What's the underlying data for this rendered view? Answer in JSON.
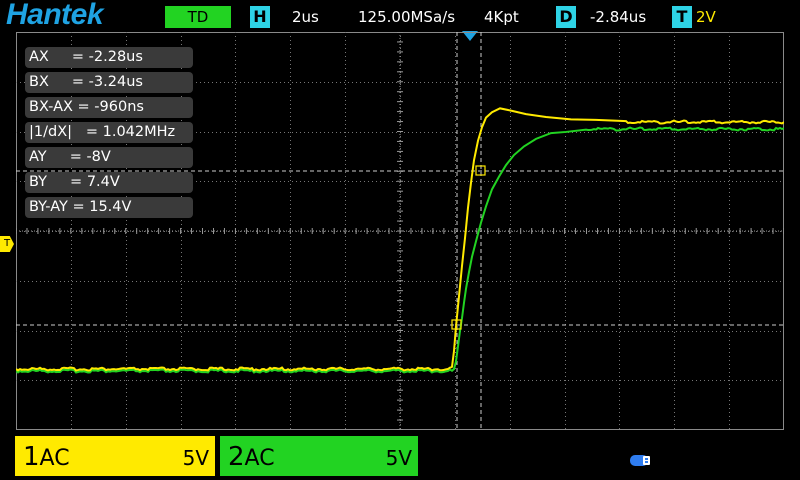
{
  "header": {
    "logo": "Hantek",
    "trigger_mode": "TD",
    "horizontal_label": "H",
    "timebase": "2us",
    "sample_rate": "125.00MSa/s",
    "memory_depth": "4Kpt",
    "delay_label": "D",
    "delay_value": "-2.84us",
    "trigger_label": "T",
    "trigger_level": "2V"
  },
  "measurements": [
    "AX     = -2.28us",
    "BX     = -3.24us",
    "BX-AX = -960ns",
    "|1/dX|   = 1.042MHz",
    "AY     = -8V",
    "BY     = 7.4V",
    "BY-AY = 15.4V"
  ],
  "trigger_level_marker": "T",
  "channels": [
    {
      "number": "1",
      "coupling": "AC",
      "scale": "5V",
      "color": "#ffea00"
    },
    {
      "number": "2",
      "coupling": "AC",
      "scale": "5V",
      "color": "#22d322"
    }
  ],
  "colors": {
    "accent": "#1fa3e3",
    "ch1": "#ffea00",
    "ch2": "#22d322",
    "cyan_label": "#2ed3e6"
  },
  "icons": {
    "usb": "usb-icon",
    "trigger_position": "triangle-down-icon"
  }
}
